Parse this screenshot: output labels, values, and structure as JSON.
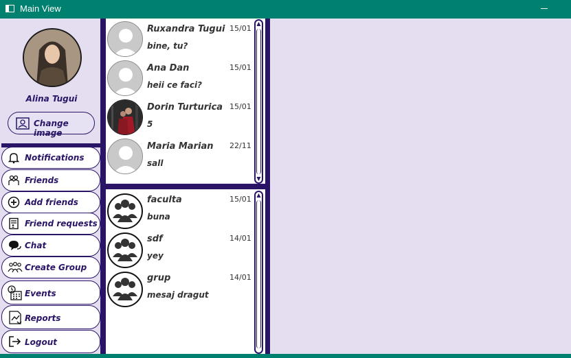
{
  "window": {
    "title": "Main View"
  },
  "profile": {
    "name": "Alina Tugui",
    "change_image_label": "Change image"
  },
  "nav": [
    {
      "label": "Notifications",
      "icon": "bell-icon"
    },
    {
      "label": "Friends",
      "icon": "friends-icon"
    },
    {
      "label": "Add friends",
      "icon": "add-circle-icon"
    },
    {
      "label": "Friend requests",
      "icon": "request-document-icon"
    },
    {
      "label": "Chat",
      "icon": "chat-bubbles-icon"
    },
    {
      "label": "Create Group",
      "icon": "group-icon"
    },
    {
      "label": "Events",
      "icon": "calendar-clock-icon"
    },
    {
      "label": "Reports",
      "icon": "report-chart-icon"
    },
    {
      "label": "Logout",
      "icon": "logout-icon"
    }
  ],
  "conversations": [
    {
      "name": "Ruxandra Tugui",
      "date": "15/01",
      "message": "bine, tu?"
    },
    {
      "name": "Ana Dan",
      "date": "15/01",
      "message": "heii ce faci?"
    },
    {
      "name": "Dorin Turturica",
      "date": "15/01",
      "message": "5"
    },
    {
      "name": "Maria Marian",
      "date": "22/11",
      "message": "sall"
    }
  ],
  "groups": [
    {
      "name": "faculta",
      "date": "15/01",
      "message": "buna"
    },
    {
      "name": "sdf",
      "date": "14/01",
      "message": "yey"
    },
    {
      "name": "grup",
      "date": "14/01",
      "message": "mesaj dragut"
    }
  ]
}
